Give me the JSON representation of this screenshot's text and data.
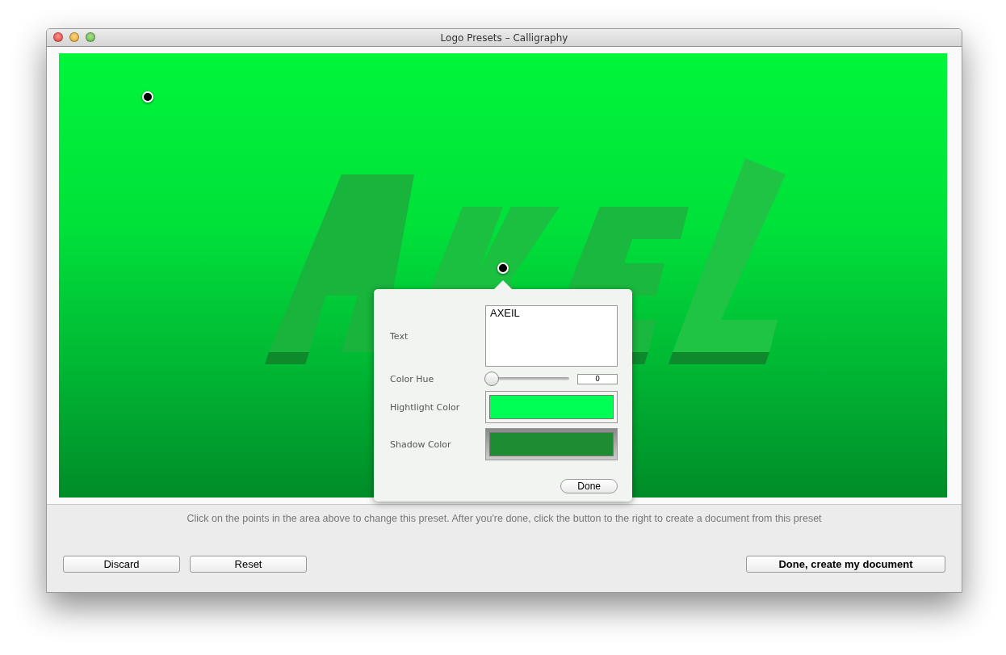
{
  "window": {
    "title": "Logo Presets – Calligraphy"
  },
  "popover": {
    "text_label": "Text",
    "text_value": "AXEIL",
    "hue": {
      "label": "Color Hue",
      "level": 0,
      "reading": "0"
    },
    "color_wells": [
      {
        "label": "Hightlight Color",
        "color": "#00ff55",
        "selected": false
      },
      {
        "label": "Shadow Color",
        "color": "#1e8c32",
        "selected": true
      }
    ],
    "done_button": "Done"
  },
  "hint": "Click on the points in the area above to change this preset. After you're done, click the button to the right to create a document from this preset",
  "buttons": {
    "left": [
      "Discard",
      "Reset"
    ],
    "primary": "Done, create my document"
  }
}
